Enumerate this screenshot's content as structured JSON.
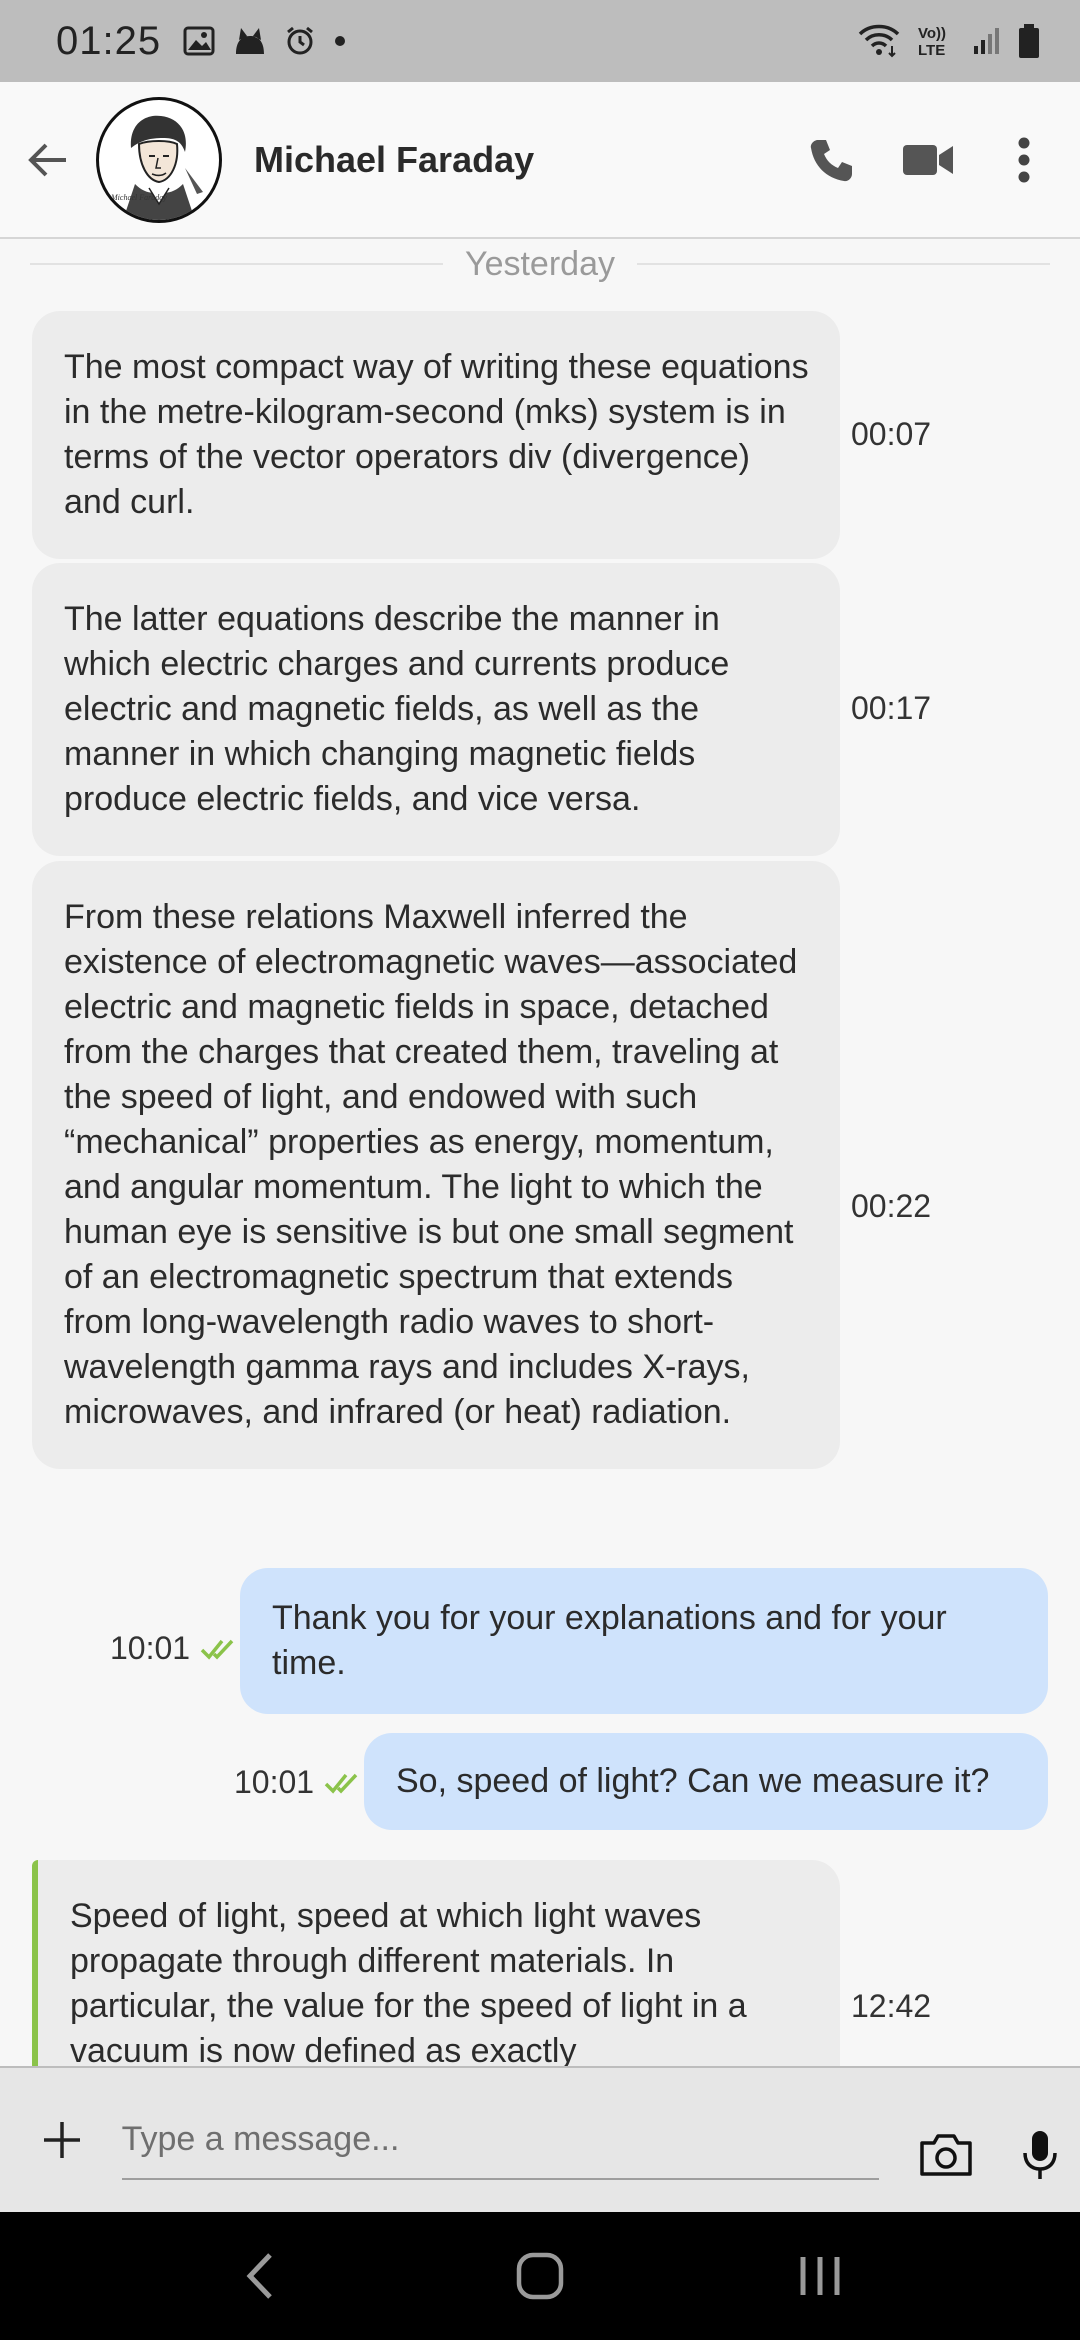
{
  "status_bar": {
    "time": "01:25",
    "left_icons": [
      "gallery-icon",
      "cat-icon",
      "alarm-icon",
      "dot-icon"
    ],
    "right_icons": [
      "wifi-icon",
      "volte-icon",
      "signal-icon",
      "battery-icon"
    ],
    "volte_text": "Vo)) LTE"
  },
  "header": {
    "contact_name": "Michael Faraday",
    "avatar_signature": "Michael Faraday"
  },
  "chat": {
    "date_separator": "Yesterday",
    "messages": [
      {
        "direction": "incoming",
        "text": "The most compact way of writing these equations in the metre-kilogram-second (mks) system is in terms of the vector operators div (divergence) and curl.",
        "time": "00:07"
      },
      {
        "direction": "incoming",
        "text": "The latter equations describe the manner in which electric charges and currents produce electric and magnetic fields, as well as the manner in which changing magnetic fields produce electric fields, and vice versa.",
        "time": "00:17"
      },
      {
        "direction": "incoming",
        "text": "From these relations Maxwell inferred the existence of electromagnetic waves—associated electric and magnetic fields in space, detached from the charges that created them, traveling at the speed of light, and endowed with such “mechanical” properties as energy, momentum, and angular momentum. The light to which the human eye is sensitive is but one small segment of an electromagnetic spectrum that extends from long-wavelength radio waves to short-wavelength gamma rays and includes X-rays, microwaves, and infrared (or heat) radiation.",
        "time": "00:22"
      },
      {
        "direction": "outgoing",
        "text": "Thank you for your explanations and for your time.",
        "time": "10:01",
        "status": "read"
      },
      {
        "direction": "outgoing",
        "text": "So, speed of light? Can we measure it?",
        "time": "10:01",
        "status": "read"
      },
      {
        "direction": "incoming",
        "text": "Speed of light, speed at which light waves propagate through different materials. In particular, the value for the speed of light in a vacuum is now defined as exactly",
        "time": "12:42"
      }
    ]
  },
  "composer": {
    "placeholder": "Type a message..."
  },
  "colors": {
    "incoming_bubble": "#ececec",
    "outgoing_bubble": "#cfe3fc",
    "read_check": "#8bc34a",
    "status_bar": "#bdbdbd"
  }
}
